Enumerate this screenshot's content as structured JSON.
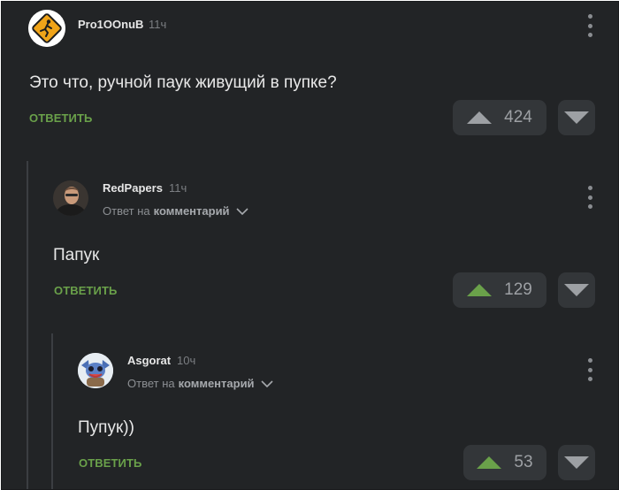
{
  "comments": [
    {
      "username": "Pro1OOnuB",
      "time": "11ч",
      "text": "Это что, ручной паук живущий в пупке?",
      "reply_label": "ОТВЕТИТЬ",
      "votes": "424",
      "upvoted": false,
      "avatar_icon": "running-man-sign-icon"
    },
    {
      "username": "RedPapers",
      "time": "11ч",
      "reply_to_prefix": "Ответ на",
      "reply_to_target": "комментарий",
      "text": "Папук",
      "reply_label": "ОТВЕТИТЬ",
      "votes": "129",
      "upvoted": true,
      "avatar_icon": "man-portrait-icon"
    },
    {
      "username": "Asgorat",
      "time": "10ч",
      "reply_to_prefix": "Ответ на",
      "reply_to_target": "комментарий",
      "text": "Пупук))",
      "reply_label": "ОТВЕТИТЬ",
      "votes": "53",
      "upvoted": true,
      "avatar_icon": "stitch-character-icon"
    }
  ],
  "colors": {
    "background": "#222426",
    "accent_green": "#6aa14a",
    "upvoted_arrow": "#6aa14a",
    "neutral_arrow": "#9da0a4"
  }
}
